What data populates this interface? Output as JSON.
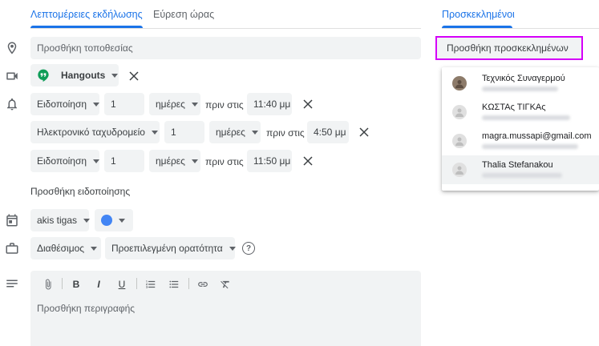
{
  "tabs": {
    "details": "Λεπτομέρειες εκδήλωσης",
    "find_time": "Εύρεση ώρας",
    "guests": "Προσκεκλημένοι"
  },
  "location": {
    "placeholder": "Προσθήκη τοποθεσίας"
  },
  "conference": {
    "label": "Hangouts"
  },
  "notifications": [
    {
      "type": "Ειδοποίηση",
      "amount": "1",
      "unit": "ημέρες",
      "before": "πριν στις",
      "time": "11:40 μμ"
    },
    {
      "type": "Ηλεκτρονικό ταχυδρομείο",
      "amount": "1",
      "unit": "ημέρες",
      "before": "πριν στις",
      "time": "4:50 μμ"
    },
    {
      "type": "Ειδοποίηση",
      "amount": "1",
      "unit": "ημέρες",
      "before": "πριν στις",
      "time": "11:50 μμ"
    }
  ],
  "add_notification": "Προσθήκη ειδοποίησης",
  "calendar": {
    "owner": "akis tigas",
    "color": "#4285f4"
  },
  "availability": {
    "status": "Διαθέσιμος",
    "visibility": "Προεπιλεγμένη ορατότητα"
  },
  "description": {
    "placeholder": "Προσθήκη περιγραφής"
  },
  "guests": {
    "input_placeholder": "Προσθήκη προσκεκλημένων",
    "suggestions": [
      {
        "name": "Τεχνικός Συναγερμού"
      },
      {
        "name": "ΚΩΣΤΑς ΤΙΓΚΑς"
      },
      {
        "name": "magra.mussapi@gmail.com"
      },
      {
        "name": "Thalia Stefanakou"
      }
    ]
  },
  "colors": {
    "accent": "#1a73e8",
    "highlight_border": "#d500f9"
  }
}
